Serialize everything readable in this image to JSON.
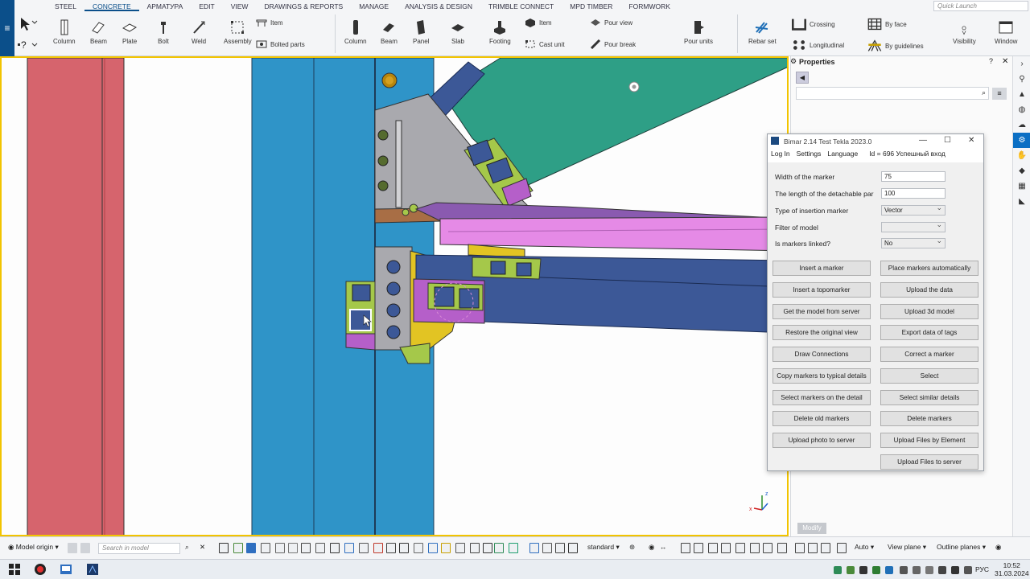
{
  "ribbon": {
    "menu_icon": "hamburger-icon",
    "tabs": [
      "STEEL",
      "CONCRETE",
      "АРМАТУРА",
      "EDIT",
      "VIEW",
      "DRAWINGS & REPORTS",
      "MANAGE",
      "ANALYSIS & DESIGN",
      "TRIMBLE CONNECT",
      "MPD TIMBER",
      "FORMWORK"
    ],
    "active_tab": "CONCRETE",
    "quick_launch_placeholder": "Quick Launch",
    "steel_tools": {
      "column": "Column",
      "beam": "Beam",
      "plate": "Plate",
      "bolt": "Bolt",
      "weld": "Weld",
      "assembly": "Assembly",
      "item": "Item",
      "bolted_parts": "Bolted parts"
    },
    "concrete_tools": {
      "column": "Column",
      "beam": "Beam",
      "panel": "Panel",
      "slab": "Slab",
      "footing": "Footing",
      "item": "Item",
      "cast_unit": "Cast unit",
      "pour_view": "Pour view",
      "pour_break": "Pour break",
      "pour_units": "Pour units"
    },
    "rebar_tools": {
      "rebar_set": "Rebar set",
      "crossing": "Crossing",
      "longitudinal": "Longitudinal",
      "by_face": "By face",
      "by_guidelines": "By guidelines",
      "visibility": "Visibility",
      "window": "Window"
    }
  },
  "properties": {
    "title": "Properties",
    "help": "?",
    "close": "✕",
    "back": "◀",
    "modify": "Modify"
  },
  "bimar": {
    "title": "Bimar 2.14 Test    Tekla 2023.0",
    "window_controls": [
      "—",
      "☐",
      "✕"
    ],
    "menu": [
      "Log In",
      "Settings",
      "Language"
    ],
    "status": "Id = 696 Успешный вход",
    "fields": [
      {
        "label": "Width of the marker",
        "value": "75",
        "type": "text"
      },
      {
        "label": "The length of the detachable par",
        "value": "100",
        "type": "text"
      },
      {
        "label": "Type of insertion marker",
        "value": "Vector",
        "type": "select"
      },
      {
        "label": "Filter of model",
        "value": "",
        "type": "select"
      },
      {
        "label": "Is markers linked?",
        "value": "No",
        "type": "select"
      }
    ],
    "buttons_left": [
      "Insert a marker",
      "Insert a topomarker",
      "Get the model from server",
      "Restore the original view",
      "Draw Connections",
      "Copy markers to typical details",
      "Select markers on the detail",
      "Delete old markers",
      "Upload photo to server"
    ],
    "buttons_right": [
      "Place markers automatically",
      "Upload the data",
      "Upload 3d model",
      "Export data of tags",
      "Correct a marker",
      "Select",
      "Select similar details",
      "Delete markers",
      "Upload Files by Element",
      "Upload Files to server"
    ]
  },
  "statusbar": {
    "model_origin": "Model origin",
    "search_placeholder": "Search in model",
    "standard": "standard",
    "auto": "Auto",
    "view_plane": "View plane",
    "outline_planes": "Outline planes"
  },
  "taskbar": {
    "lang": "РУС",
    "time": "10:52",
    "date": "31.03.2024"
  },
  "colors": {
    "accent": "#0b6fc4",
    "viewport_border": "#f2c400",
    "column_red": "#d6646d",
    "column_blue": "#2f94c8",
    "beam_green": "#2e9f86",
    "beam_navy": "#3c5897",
    "beam_pink": "#e58ae6",
    "plate_yellow": "#e2c423",
    "plate_purple": "#b55fc9",
    "plate_gray": "#a9a9ae"
  }
}
